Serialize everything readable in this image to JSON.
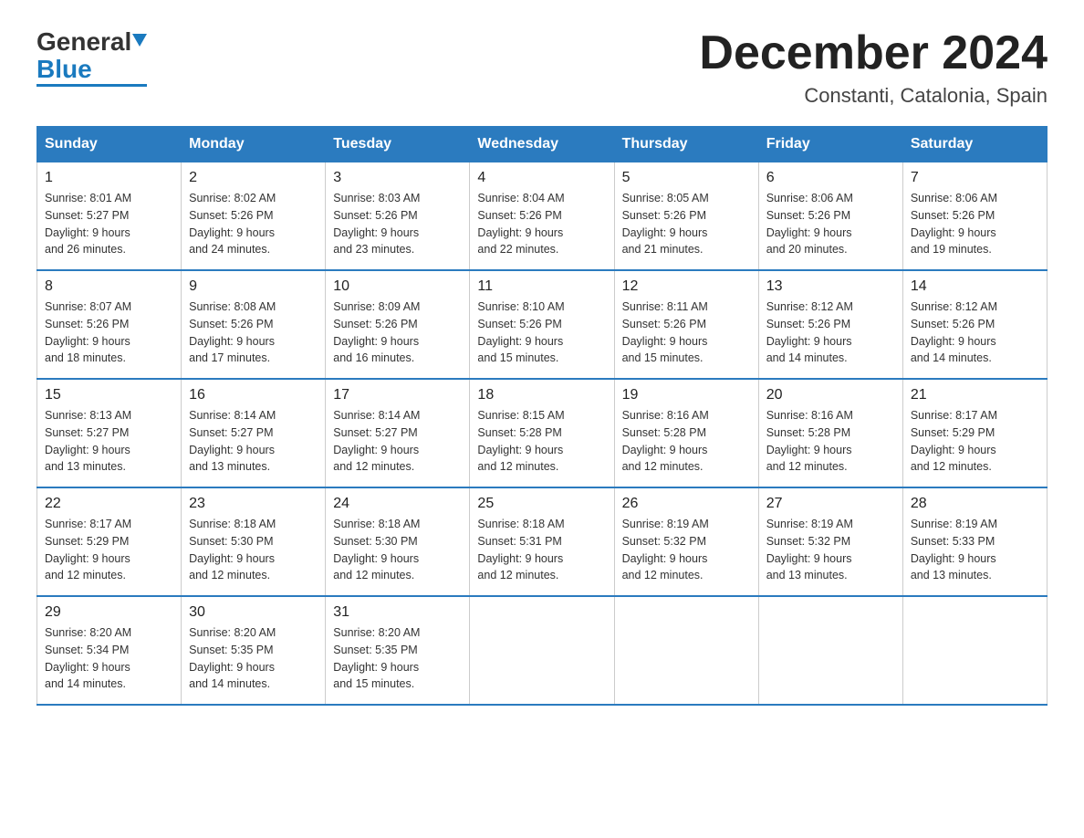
{
  "header": {
    "month_title": "December 2024",
    "location": "Constanti, Catalonia, Spain",
    "logo_general": "General",
    "logo_blue": "Blue"
  },
  "weekdays": [
    "Sunday",
    "Monday",
    "Tuesday",
    "Wednesday",
    "Thursday",
    "Friday",
    "Saturday"
  ],
  "weeks": [
    [
      {
        "day": "1",
        "sunrise": "8:01 AM",
        "sunset": "5:27 PM",
        "daylight": "9 hours and 26 minutes."
      },
      {
        "day": "2",
        "sunrise": "8:02 AM",
        "sunset": "5:26 PM",
        "daylight": "9 hours and 24 minutes."
      },
      {
        "day": "3",
        "sunrise": "8:03 AM",
        "sunset": "5:26 PM",
        "daylight": "9 hours and 23 minutes."
      },
      {
        "day": "4",
        "sunrise": "8:04 AM",
        "sunset": "5:26 PM",
        "daylight": "9 hours and 22 minutes."
      },
      {
        "day": "5",
        "sunrise": "8:05 AM",
        "sunset": "5:26 PM",
        "daylight": "9 hours and 21 minutes."
      },
      {
        "day": "6",
        "sunrise": "8:06 AM",
        "sunset": "5:26 PM",
        "daylight": "9 hours and 20 minutes."
      },
      {
        "day": "7",
        "sunrise": "8:06 AM",
        "sunset": "5:26 PM",
        "daylight": "9 hours and 19 minutes."
      }
    ],
    [
      {
        "day": "8",
        "sunrise": "8:07 AM",
        "sunset": "5:26 PM",
        "daylight": "9 hours and 18 minutes."
      },
      {
        "day": "9",
        "sunrise": "8:08 AM",
        "sunset": "5:26 PM",
        "daylight": "9 hours and 17 minutes."
      },
      {
        "day": "10",
        "sunrise": "8:09 AM",
        "sunset": "5:26 PM",
        "daylight": "9 hours and 16 minutes."
      },
      {
        "day": "11",
        "sunrise": "8:10 AM",
        "sunset": "5:26 PM",
        "daylight": "9 hours and 15 minutes."
      },
      {
        "day": "12",
        "sunrise": "8:11 AM",
        "sunset": "5:26 PM",
        "daylight": "9 hours and 15 minutes."
      },
      {
        "day": "13",
        "sunrise": "8:12 AM",
        "sunset": "5:26 PM",
        "daylight": "9 hours and 14 minutes."
      },
      {
        "day": "14",
        "sunrise": "8:12 AM",
        "sunset": "5:26 PM",
        "daylight": "9 hours and 14 minutes."
      }
    ],
    [
      {
        "day": "15",
        "sunrise": "8:13 AM",
        "sunset": "5:27 PM",
        "daylight": "9 hours and 13 minutes."
      },
      {
        "day": "16",
        "sunrise": "8:14 AM",
        "sunset": "5:27 PM",
        "daylight": "9 hours and 13 minutes."
      },
      {
        "day": "17",
        "sunrise": "8:14 AM",
        "sunset": "5:27 PM",
        "daylight": "9 hours and 12 minutes."
      },
      {
        "day": "18",
        "sunrise": "8:15 AM",
        "sunset": "5:28 PM",
        "daylight": "9 hours and 12 minutes."
      },
      {
        "day": "19",
        "sunrise": "8:16 AM",
        "sunset": "5:28 PM",
        "daylight": "9 hours and 12 minutes."
      },
      {
        "day": "20",
        "sunrise": "8:16 AM",
        "sunset": "5:28 PM",
        "daylight": "9 hours and 12 minutes."
      },
      {
        "day": "21",
        "sunrise": "8:17 AM",
        "sunset": "5:29 PM",
        "daylight": "9 hours and 12 minutes."
      }
    ],
    [
      {
        "day": "22",
        "sunrise": "8:17 AM",
        "sunset": "5:29 PM",
        "daylight": "9 hours and 12 minutes."
      },
      {
        "day": "23",
        "sunrise": "8:18 AM",
        "sunset": "5:30 PM",
        "daylight": "9 hours and 12 minutes."
      },
      {
        "day": "24",
        "sunrise": "8:18 AM",
        "sunset": "5:30 PM",
        "daylight": "9 hours and 12 minutes."
      },
      {
        "day": "25",
        "sunrise": "8:18 AM",
        "sunset": "5:31 PM",
        "daylight": "9 hours and 12 minutes."
      },
      {
        "day": "26",
        "sunrise": "8:19 AM",
        "sunset": "5:32 PM",
        "daylight": "9 hours and 12 minutes."
      },
      {
        "day": "27",
        "sunrise": "8:19 AM",
        "sunset": "5:32 PM",
        "daylight": "9 hours and 13 minutes."
      },
      {
        "day": "28",
        "sunrise": "8:19 AM",
        "sunset": "5:33 PM",
        "daylight": "9 hours and 13 minutes."
      }
    ],
    [
      {
        "day": "29",
        "sunrise": "8:20 AM",
        "sunset": "5:34 PM",
        "daylight": "9 hours and 14 minutes."
      },
      {
        "day": "30",
        "sunrise": "8:20 AM",
        "sunset": "5:35 PM",
        "daylight": "9 hours and 14 minutes."
      },
      {
        "day": "31",
        "sunrise": "8:20 AM",
        "sunset": "5:35 PM",
        "daylight": "9 hours and 15 minutes."
      },
      null,
      null,
      null,
      null
    ]
  ],
  "labels": {
    "sunrise": "Sunrise:",
    "sunset": "Sunset:",
    "daylight": "Daylight:"
  }
}
